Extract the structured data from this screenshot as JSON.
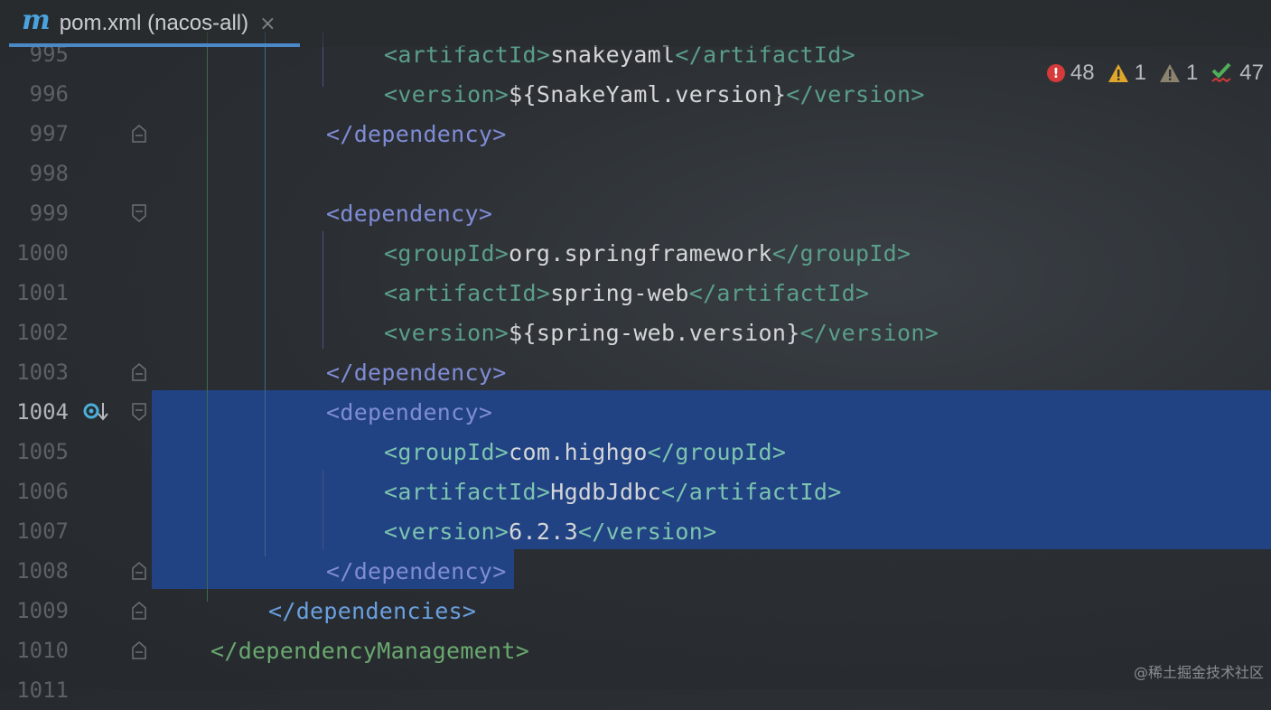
{
  "tab": {
    "icon_letter": "m",
    "title": "pom.xml (nacos-all)",
    "close_glyph": "×"
  },
  "inspections": {
    "errors": "48",
    "warnings": "1",
    "weak_warnings": "1",
    "typos": "47"
  },
  "lines": [
    {
      "num": "995",
      "indent": 4,
      "parts": [
        [
          "tag",
          "<artifactId>"
        ],
        [
          "txt",
          "snakeyaml"
        ],
        [
          "tag",
          "</artifactId>"
        ]
      ]
    },
    {
      "num": "996",
      "indent": 4,
      "parts": [
        [
          "tag",
          "<version>"
        ],
        [
          "txt",
          "${SnakeYaml.version}"
        ],
        [
          "tag",
          "</version>"
        ]
      ]
    },
    {
      "num": "997",
      "indent": 3,
      "parts": [
        [
          "tagb",
          "</dependency>"
        ]
      ]
    },
    {
      "num": "998",
      "indent": 0,
      "parts": []
    },
    {
      "num": "999",
      "indent": 3,
      "parts": [
        [
          "tagb",
          "<dependency>"
        ]
      ]
    },
    {
      "num": "1000",
      "indent": 4,
      "parts": [
        [
          "tag",
          "<groupId>"
        ],
        [
          "txt",
          "org.springframework"
        ],
        [
          "tag",
          "</groupId>"
        ]
      ]
    },
    {
      "num": "1001",
      "indent": 4,
      "parts": [
        [
          "tag",
          "<artifactId>"
        ],
        [
          "txt",
          "spring-web"
        ],
        [
          "tag",
          "</artifactId>"
        ]
      ]
    },
    {
      "num": "1002",
      "indent": 4,
      "parts": [
        [
          "tag",
          "<version>"
        ],
        [
          "txt",
          "${spring-web.version}"
        ],
        [
          "tag",
          "</version>"
        ]
      ]
    },
    {
      "num": "1003",
      "indent": 3,
      "parts": [
        [
          "tagb",
          "</dependency>"
        ]
      ]
    },
    {
      "num": "1004",
      "indent": 3,
      "parts": [
        [
          "tagb",
          "<dependency>"
        ]
      ]
    },
    {
      "num": "1005",
      "indent": 4,
      "parts": [
        [
          "tag",
          "<groupId>"
        ],
        [
          "txt",
          "com.highgo"
        ],
        [
          "tag",
          "</groupId>"
        ]
      ]
    },
    {
      "num": "1006",
      "indent": 4,
      "parts": [
        [
          "tag",
          "<artifactId>"
        ],
        [
          "txt",
          "HgdbJdbc"
        ],
        [
          "tag",
          "</artifactId>"
        ]
      ]
    },
    {
      "num": "1007",
      "indent": 4,
      "parts": [
        [
          "tag",
          "<version>"
        ],
        [
          "txt",
          "6.2.3"
        ],
        [
          "tag",
          "</version>"
        ]
      ]
    },
    {
      "num": "1008",
      "indent": 3,
      "parts": [
        [
          "tagb",
          "</dependency>"
        ]
      ]
    },
    {
      "num": "1009",
      "indent": 2,
      "parts": [
        [
          "tagb2",
          "</dependencies>"
        ]
      ]
    },
    {
      "num": "1010",
      "indent": 1,
      "parts": [
        [
          "tagg",
          "</dependencyManagement>"
        ]
      ]
    },
    {
      "num": "1011",
      "indent": 0,
      "parts": []
    }
  ],
  "watermark": "@稀土掘金技术社区",
  "colors": {
    "selection": "#214283",
    "accent": "#4a88c7",
    "error": "#d63a3a",
    "warning": "#e0a52b"
  }
}
